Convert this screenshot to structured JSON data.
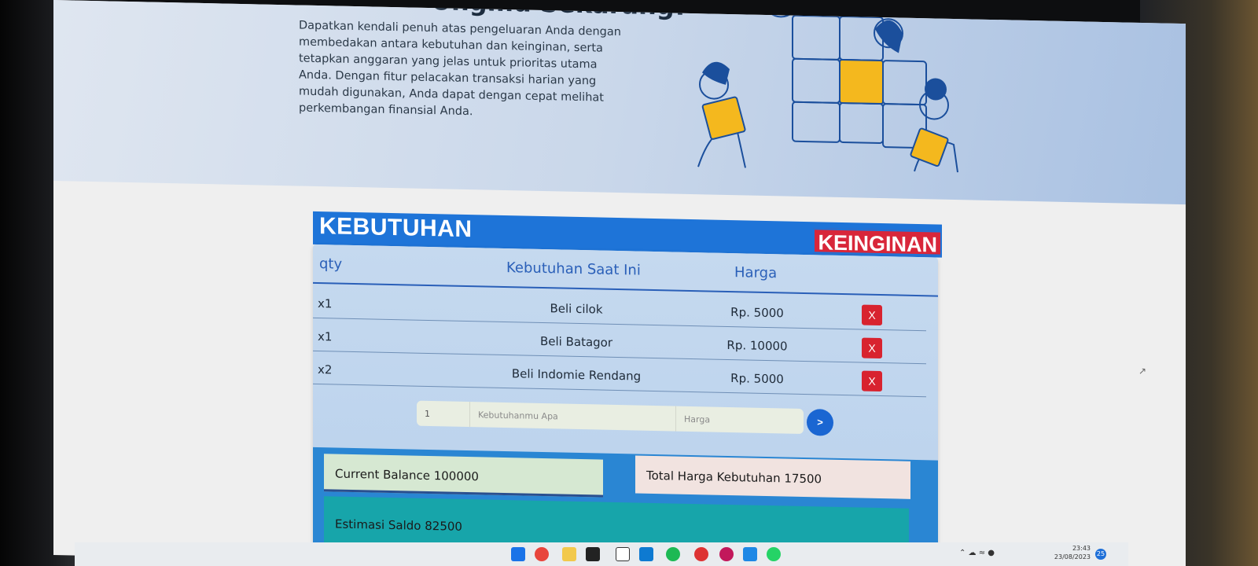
{
  "hero": {
    "heading": "Ungmu Sekarang!",
    "paragraph": "Dapatkan kendali penuh atas pengeluaran Anda dengan membedakan antara kebutuhan dan keinginan, serta tetapkan anggaran yang jelas untuk prioritas utama Anda. Dengan fitur pelacakan transaksi harian yang mudah digunakan, Anda dapat dengan cepat melihat perkembangan finansial Anda."
  },
  "tabs": {
    "kebutuhan": "KEBUTUHAN",
    "keinginan": "KEINGINAN"
  },
  "table": {
    "headers": {
      "qty": "qty",
      "item": "Kebutuhan Saat Ini",
      "harga": "Harga"
    },
    "rows": [
      {
        "qty": "x1",
        "item": "Beli cilok",
        "harga": "Rp. 5000",
        "delete": "X"
      },
      {
        "qty": "x1",
        "item": "Beli Batagor",
        "harga": "Rp. 10000",
        "delete": "X"
      },
      {
        "qty": "x2",
        "item": "Beli Indomie Rendang",
        "harga": "Rp. 5000",
        "delete": "X"
      }
    ]
  },
  "form": {
    "qty_value": "1",
    "name_placeholder": "Kebutuhanmu Apa",
    "harga_placeholder": "Harga",
    "submit_label": ">"
  },
  "summary": {
    "balance": "Current Balance 100000",
    "total": "Total Harga Kebutuhan 17500",
    "estimasi": "Estimasi Saldo 82500"
  },
  "taskbar": {
    "time": "23:43",
    "date": "23/08/2023",
    "notifications": "25"
  },
  "colors": {
    "primary_blue": "#1e74d8",
    "danger_red": "#d8263a",
    "teal": "#17a5aa"
  }
}
